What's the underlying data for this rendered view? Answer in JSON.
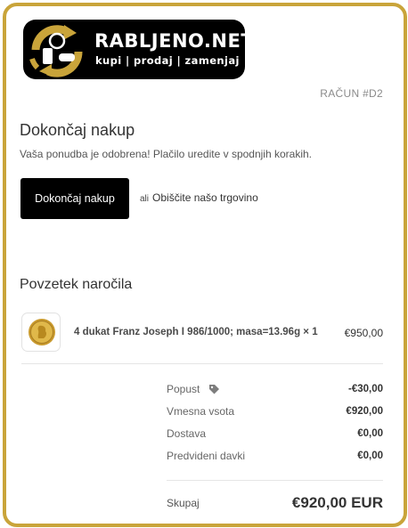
{
  "brand": {
    "name": "RABLJENO.NET",
    "tagline": "kupi | prodaj | zamenjaj",
    "accent": "#c9a43a"
  },
  "order": {
    "number_label": "RAČUN #D2"
  },
  "checkout": {
    "title": "Dokončaj nakup",
    "message": "Vaša ponudba je odobrena! Plačilo uredite v spodnjih korakih.",
    "finish_button": "Dokončaj nakup",
    "or_text": "ali",
    "shop_link": "Obiščite našo trgovino"
  },
  "summary": {
    "title": "Povzetek naročila",
    "item": {
      "name": "4 dukat Franz Joseph I 986/1000; masa=13.96g × 1",
      "price": "€950,00",
      "image_icon": "gold-coin-icon"
    },
    "rows": [
      {
        "label": "Popust",
        "value": "-€30,00",
        "icon": "tag-icon"
      },
      {
        "label": "Vmesna vsota",
        "value": "€920,00"
      },
      {
        "label": "Dostava",
        "value": "€0,00"
      },
      {
        "label": "Predvideni davki",
        "value": "€0,00"
      }
    ],
    "total_label": "Skupaj",
    "total_value": "€920,00 EUR"
  }
}
